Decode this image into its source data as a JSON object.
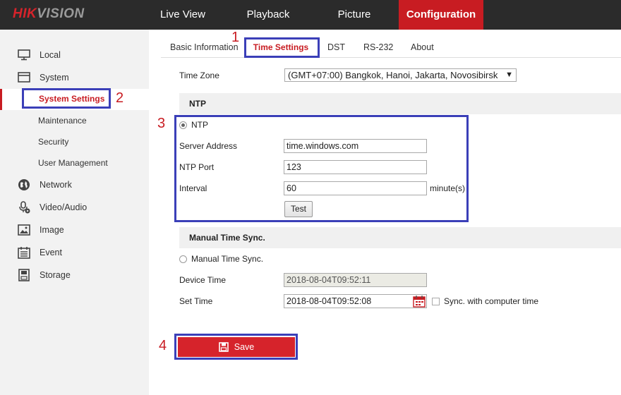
{
  "brand": {
    "logo_red": "HIK",
    "logo_grey": "VISION"
  },
  "topnav": {
    "live_view": "Live View",
    "playback": "Playback",
    "picture": "Picture",
    "configuration": "Configuration"
  },
  "sidebar": {
    "local": "Local",
    "system": "System",
    "system_settings": "System Settings",
    "maintenance": "Maintenance",
    "security": "Security",
    "user_management": "User Management",
    "network": "Network",
    "video_audio": "Video/Audio",
    "image": "Image",
    "event": "Event",
    "storage": "Storage"
  },
  "tabs": {
    "basic_information": "Basic Information",
    "time_settings": "Time Settings",
    "dst": "DST",
    "rs232": "RS-232",
    "about": "About"
  },
  "time_zone": {
    "label": "Time Zone",
    "value": "(GMT+07:00) Bangkok, Hanoi, Jakarta, Novosibirsk"
  },
  "ntp": {
    "section_title": "NTP",
    "radio_label": "NTP",
    "server_address_label": "Server Address",
    "server_address_value": "time.windows.com",
    "port_label": "NTP Port",
    "port_value": "123",
    "interval_label": "Interval",
    "interval_value": "60",
    "interval_unit": "minute(s)",
    "test_button": "Test"
  },
  "manual": {
    "section_title": "Manual Time Sync.",
    "radio_label": "Manual Time Sync.",
    "device_time_label": "Device Time",
    "device_time_value": "2018-08-04T09:52:11",
    "set_time_label": "Set Time",
    "set_time_value": "2018-08-04T09:52:08",
    "sync_label": "Sync. with computer time"
  },
  "save_button": "Save",
  "annotations": {
    "n1": "1",
    "n2": "2",
    "n3": "3",
    "n4": "4"
  },
  "colors": {
    "accent": "#c81c22",
    "topbar": "#2b2b2b",
    "annotation_box": "#3b3fb8"
  }
}
